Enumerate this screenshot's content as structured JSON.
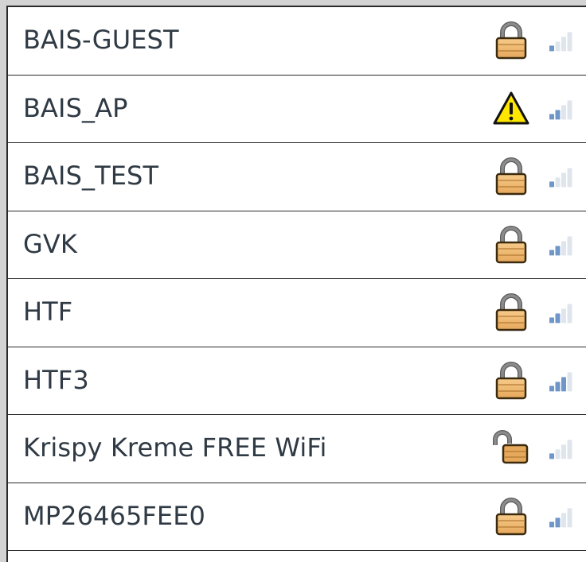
{
  "networks": [
    {
      "ssid": "BAIS-GUEST",
      "security": "lock-closed",
      "signal_bars": 1
    },
    {
      "ssid": "BAIS_AP",
      "security": "warning",
      "signal_bars": 2
    },
    {
      "ssid": "BAIS_TEST",
      "security": "lock-closed",
      "signal_bars": 1
    },
    {
      "ssid": "GVK",
      "security": "lock-closed",
      "signal_bars": 2
    },
    {
      "ssid": "HTF",
      "security": "lock-closed",
      "signal_bars": 2
    },
    {
      "ssid": "HTF3",
      "security": "lock-closed",
      "signal_bars": 3
    },
    {
      "ssid": "Krispy Kreme FREE WiFi",
      "security": "lock-open",
      "signal_bars": 1
    },
    {
      "ssid": "MP26465FEE0",
      "security": "lock-closed",
      "signal_bars": 2
    }
  ],
  "colors": {
    "background": "#d3d3d3",
    "list_background": "#ffffff",
    "border": "#2a2a2a",
    "text": "#2f3a44",
    "lock_body": "#e6a85a",
    "lock_shackle": "#8c8c8c",
    "warning_fill": "#ffe600",
    "signal_on": "#6f96c9",
    "signal_off": "#dfe5ec"
  },
  "icons": {
    "lock-closed": "padlock-closed-icon",
    "lock-open": "padlock-open-icon",
    "warning": "warning-triangle-icon",
    "signal": "signal-strength-icon"
  }
}
